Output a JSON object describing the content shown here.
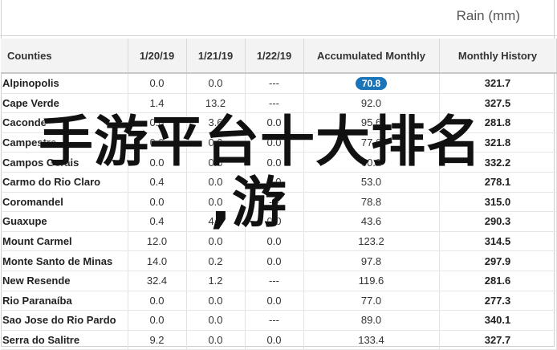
{
  "header": {
    "unit_label": "Rain (mm)"
  },
  "table": {
    "columns": [
      "Counties",
      "1/20/19",
      "1/21/19",
      "1/22/19",
      "Accumulated Monthly",
      "Monthly History"
    ],
    "rows": [
      [
        "Alpinopolis",
        "0.0",
        "0.0",
        "---",
        "70.8",
        "321.7"
      ],
      [
        "Cape Verde",
        "1.4",
        "13.2",
        "---",
        "92.0",
        "327.5"
      ],
      [
        "Caconde",
        "0.0",
        "3.6",
        "0.0",
        "95.6",
        "281.8"
      ],
      [
        "Campestre",
        "0.0",
        "0.0",
        "0.0",
        "77.6",
        "321.8"
      ],
      [
        "Campos Gerais",
        "0.0",
        "0.0",
        "0.0",
        "60.2",
        "332.2"
      ],
      [
        "Carmo do Rio Claro",
        "0.4",
        "0.0",
        "0.0",
        "53.0",
        "278.1"
      ],
      [
        "Coromandel",
        "0.0",
        "0.0",
        "---",
        "78.8",
        "315.0"
      ],
      [
        "Guaxupe",
        "0.4",
        "4.2",
        "0.0",
        "43.6",
        "290.3"
      ],
      [
        "Mount Carmel",
        "12.0",
        "0.0",
        "0.0",
        "123.2",
        "314.5"
      ],
      [
        "Monte Santo de Minas",
        "14.0",
        "0.2",
        "0.0",
        "97.8",
        "297.9"
      ],
      [
        "New Resende",
        "32.4",
        "1.2",
        "---",
        "119.6",
        "281.6"
      ],
      [
        "Rio Paranaíba",
        "0.0",
        "0.0",
        "0.0",
        "77.0",
        "277.3"
      ],
      [
        "Sao Jose do Rio Pardo",
        "0.0",
        "0.0",
        "---",
        "89.0",
        "340.1"
      ],
      [
        "Serra do Salitre",
        "9.2",
        "0.0",
        "0.0",
        "133.4",
        "327.7"
      ]
    ],
    "highlighted_cell": {
      "row": 0,
      "col": 4,
      "color": "#1a74b8"
    }
  },
  "overlay": {
    "line1": "手游平台十大排名",
    "line2": ",游"
  }
}
